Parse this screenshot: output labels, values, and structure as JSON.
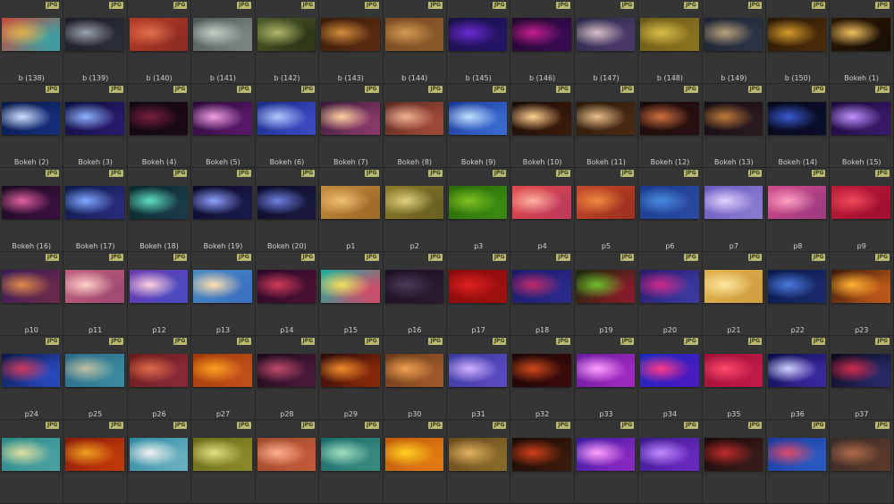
{
  "badge_text": "JPG",
  "items": [
    {
      "label": "b (138)",
      "colors": [
        "#c94a3a",
        "#e1b04f",
        "#3aa0a6"
      ]
    },
    {
      "label": "b (139)",
      "colors": [
        "#1c1f27",
        "#9aa2ad",
        "#2a2d36"
      ]
    },
    {
      "label": "b (140)",
      "colors": [
        "#b33c28",
        "#e1704a",
        "#8f2c22"
      ]
    },
    {
      "label": "b (141)",
      "colors": [
        "#4f5754",
        "#c4ccc6",
        "#7d8682"
      ]
    },
    {
      "label": "b (142)",
      "colors": [
        "#4c5a2a",
        "#b1b86b",
        "#2c3517"
      ]
    },
    {
      "label": "b (143)",
      "colors": [
        "#3b1d0a",
        "#d08c3c",
        "#5b2b10"
      ]
    },
    {
      "label": "b (144)",
      "colors": [
        "#7a4a22",
        "#d49a52",
        "#8b5a2b"
      ]
    },
    {
      "label": "b (145)",
      "colors": [
        "#1b1048",
        "#6b2ad4",
        "#241466"
      ]
    },
    {
      "label": "b (146)",
      "colors": [
        "#22082e",
        "#c21e8e",
        "#3a0b52"
      ]
    },
    {
      "label": "b (147)",
      "colors": [
        "#2a2a4a",
        "#d6c0c8",
        "#4c3a6a"
      ]
    },
    {
      "label": "b (148)",
      "colors": [
        "#6b5a18",
        "#d8be48",
        "#8a7320"
      ]
    },
    {
      "label": "b (149)",
      "colors": [
        "#1e2433",
        "#b9a27c",
        "#2c3344"
      ]
    },
    {
      "label": "b (150)",
      "colors": [
        "#2a1906",
        "#d49a2a",
        "#4a2c0a"
      ]
    },
    {
      "label": "Bokeh (1)",
      "colors": [
        "#2a1806",
        "#f0c060",
        "#1a0f04"
      ]
    },
    {
      "label": "Bokeh (2)",
      "colors": [
        "#0a1a4a",
        "#cfe0ff",
        "#152e7a"
      ]
    },
    {
      "label": "Bokeh (3)",
      "colors": [
        "#0a1040",
        "#8fb2ff",
        "#2a1a6a"
      ]
    },
    {
      "label": "Bokeh (4)",
      "colors": [
        "#120810",
        "#7a2040",
        "#1a0a14"
      ]
    },
    {
      "label": "Bokeh (5)",
      "colors": [
        "#2a0a3a",
        "#f0a0e0",
        "#5a1a6a"
      ]
    },
    {
      "label": "Bokeh (6)",
      "colors": [
        "#1a2a8a",
        "#b0c8ff",
        "#3a4ac0"
      ]
    },
    {
      "label": "Bokeh (7)",
      "colors": [
        "#3a1a3a",
        "#ffcfa0",
        "#8a3a6a"
      ]
    },
    {
      "label": "Bokeh (8)",
      "colors": [
        "#5a2a20",
        "#f0b090",
        "#a04a3a"
      ]
    },
    {
      "label": "Bokeh (9)",
      "colors": [
        "#1a3a9a",
        "#c0e0ff",
        "#3a6ad0"
      ]
    },
    {
      "label": "Bokeh (10)",
      "colors": [
        "#1a0c06",
        "#ffd090",
        "#3a1a0a"
      ]
    },
    {
      "label": "Bokeh (11)",
      "colors": [
        "#2a1a0a",
        "#e8c08a",
        "#4a2a14"
      ]
    },
    {
      "label": "Bokeh (12)",
      "colors": [
        "#1a0a0a",
        "#d07040",
        "#2a1010"
      ]
    },
    {
      "label": "Bokeh (13)",
      "colors": [
        "#120c14",
        "#c07a3a",
        "#2a1a20"
      ]
    },
    {
      "label": "Bokeh (14)",
      "colors": [
        "#06081a",
        "#3a5ad0",
        "#0a0e2a"
      ]
    },
    {
      "label": "Bokeh (15)",
      "colors": [
        "#1a0a3a",
        "#c090ff",
        "#3a1a6a"
      ]
    },
    {
      "label": "Bokeh (16)",
      "colors": [
        "#1a0a20",
        "#e060a0",
        "#3a1040"
      ]
    },
    {
      "label": "Bokeh (17)",
      "colors": [
        "#0a1a4a",
        "#80a8ff",
        "#2a2a7a"
      ]
    },
    {
      "label": "Bokeh (18)",
      "colors": [
        "#0a2a2a",
        "#60e0c0",
        "#1a3a4a"
      ]
    },
    {
      "label": "Bokeh (19)",
      "colors": [
        "#0a0a2a",
        "#90a0ff",
        "#1a1a4a"
      ]
    },
    {
      "label": "Bokeh (20)",
      "colors": [
        "#0a0a2a",
        "#7080e0",
        "#1a1a40"
      ]
    },
    {
      "label": "p1",
      "colors": [
        "#c08a3a",
        "#f0c070",
        "#a06a2a"
      ]
    },
    {
      "label": "p2",
      "colors": [
        "#8a7a2a",
        "#e0d080",
        "#6a6020"
      ]
    },
    {
      "label": "p3",
      "colors": [
        "#2a6a0a",
        "#80c020",
        "#3a8a10"
      ]
    },
    {
      "label": "p4",
      "colors": [
        "#e04a4a",
        "#ffb0a0",
        "#c03a5a"
      ]
    },
    {
      "label": "p5",
      "colors": [
        "#c04a2a",
        "#f08a40",
        "#a03020"
      ]
    },
    {
      "label": "p6",
      "colors": [
        "#1a3a8a",
        "#4a8ae0",
        "#2a4aa0"
      ]
    },
    {
      "label": "p7",
      "colors": [
        "#6a5ac0",
        "#e0d0ff",
        "#8a7ad0"
      ]
    },
    {
      "label": "p8",
      "colors": [
        "#d04a8a",
        "#ffa0c0",
        "#a03a80"
      ]
    },
    {
      "label": "p9",
      "colors": [
        "#c01a3a",
        "#f04a5a",
        "#a01030"
      ]
    },
    {
      "label": "p10",
      "colors": [
        "#3a1a5a",
        "#e08a4a",
        "#6a2a4a"
      ]
    },
    {
      "label": "p11",
      "colors": [
        "#c06080",
        "#ffd0c8",
        "#a04a70"
      ]
    },
    {
      "label": "p12",
      "colors": [
        "#6a3ab0",
        "#ffd0e0",
        "#4a4ac0"
      ]
    },
    {
      "label": "p13",
      "colors": [
        "#4a8ac0",
        "#ffe0b0",
        "#3a70c0"
      ]
    },
    {
      "label": "p14",
      "colors": [
        "#2a0a2a",
        "#d03a5a",
        "#4a1030"
      ]
    },
    {
      "label": "p15",
      "colors": [
        "#1ab0a0",
        "#f0e060",
        "#d04a6a"
      ]
    },
    {
      "label": "p16",
      "colors": [
        "#1a1020",
        "#4a3a5a",
        "#2a1a30"
      ]
    },
    {
      "label": "p17",
      "colors": [
        "#8a0a0a",
        "#e02020",
        "#a01010"
      ]
    },
    {
      "label": "p18",
      "colors": [
        "#1a1a6a",
        "#c02a6a",
        "#2a2a8a"
      ]
    },
    {
      "label": "p19",
      "colors": [
        "#1a2a0a",
        "#6ac02a",
        "#8a1a2a"
      ]
    },
    {
      "label": "p20",
      "colors": [
        "#2a1a6a",
        "#d02a8a",
        "#3a3aa0"
      ]
    },
    {
      "label": "p21",
      "colors": [
        "#e0b050",
        "#ffe8a0",
        "#d0a040"
      ]
    },
    {
      "label": "p22",
      "colors": [
        "#0a1a4a",
        "#4a7ae0",
        "#1a2a6a"
      ]
    },
    {
      "label": "p23",
      "colors": [
        "#3a1a0a",
        "#ffb030",
        "#c05a1a"
      ]
    },
    {
      "label": "p24",
      "colors": [
        "#0a1a4a",
        "#d03a5a",
        "#2a4ac0"
      ]
    },
    {
      "label": "p25",
      "colors": [
        "#2a6a8a",
        "#c0c0a0",
        "#3a8aa0"
      ]
    },
    {
      "label": "p26",
      "colors": [
        "#6a1a1a",
        "#e06a4a",
        "#8a2a3a"
      ]
    },
    {
      "label": "p27",
      "colors": [
        "#a03a0a",
        "#ffa020",
        "#c0501a"
      ]
    },
    {
      "label": "p28",
      "colors": [
        "#1a0a1a",
        "#c04a6a",
        "#4a1a3a"
      ]
    },
    {
      "label": "p29",
      "colors": [
        "#2a0a0a",
        "#f08a2a",
        "#8a2a0a"
      ]
    },
    {
      "label": "p30",
      "colors": [
        "#6a3a1a",
        "#f0a050",
        "#a05a2a"
      ]
    },
    {
      "label": "p31",
      "colors": [
        "#3a3aa0",
        "#d0b0ff",
        "#5a4ac0"
      ]
    },
    {
      "label": "p32",
      "colors": [
        "#1a0606",
        "#d04a1a",
        "#3a0a0a"
      ]
    },
    {
      "label": "p33",
      "colors": [
        "#6a1aa0",
        "#ffa0ff",
        "#a02ac0"
      ]
    },
    {
      "label": "p34",
      "colors": [
        "#1a2ac0",
        "#ff3a8a",
        "#4a1ac0"
      ]
    },
    {
      "label": "p35",
      "colors": [
        "#a0103a",
        "#ff4a6a",
        "#c01a4a"
      ]
    },
    {
      "label": "p36",
      "colors": [
        "#0a0a4a",
        "#d0d0ff",
        "#3a2aa0"
      ]
    },
    {
      "label": "p37",
      "colors": [
        "#0a0a1a",
        "#d02a4a",
        "#2a2a6a"
      ]
    },
    {
      "label": "",
      "colors": [
        "#2a8a8a",
        "#e0e0a0",
        "#4aa0a0"
      ]
    },
    {
      "label": "",
      "colors": [
        "#8a1a0a",
        "#f0a020",
        "#c03a0a"
      ]
    },
    {
      "label": "",
      "colors": [
        "#2a8aa0",
        "#f0f0f0",
        "#6ab0c0"
      ]
    },
    {
      "label": "",
      "colors": [
        "#6a6a1a",
        "#e0e080",
        "#8a8a2a"
      ]
    },
    {
      "label": "",
      "colors": [
        "#a04a2a",
        "#ffb090",
        "#c05a3a"
      ]
    },
    {
      "label": "",
      "colors": [
        "#1a6a6a",
        "#a0e0c0",
        "#3a8a80"
      ]
    },
    {
      "label": "",
      "colors": [
        "#c05a0a",
        "#ffd020",
        "#e07a10"
      ]
    },
    {
      "label": "",
      "colors": [
        "#6a4a1a",
        "#e0b060",
        "#8a6a2a"
      ]
    },
    {
      "label": "",
      "colors": [
        "#1a0a06",
        "#d0401a",
        "#3a1a0a"
      ]
    },
    {
      "label": "",
      "colors": [
        "#3a1aa0",
        "#ffa0ff",
        "#8a2ac0"
      ]
    },
    {
      "label": "",
      "colors": [
        "#3a1a8a",
        "#c08aff",
        "#6a2ac0"
      ]
    },
    {
      "label": "",
      "colors": [
        "#1a0a0a",
        "#c02a2a",
        "#3a1a1a"
      ]
    },
    {
      "label": "",
      "colors": [
        "#1a3aa0",
        "#e04a6a",
        "#2a5ac0"
      ]
    },
    {
      "label": "",
      "colors": [
        "#3a2a2a",
        "#b06a4a",
        "#5a3a2a"
      ]
    }
  ]
}
